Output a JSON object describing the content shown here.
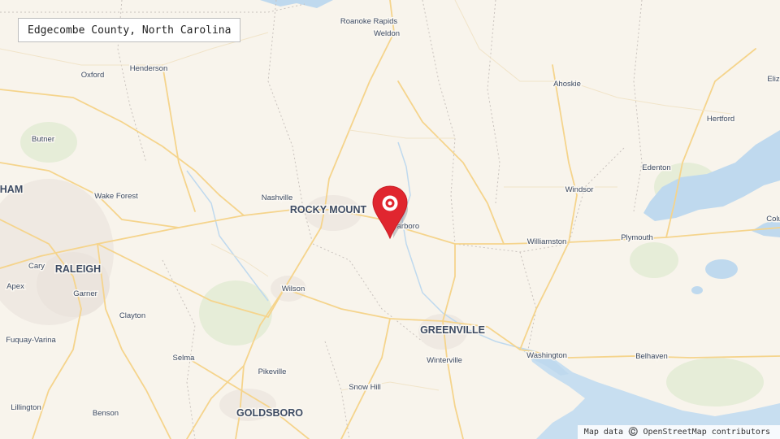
{
  "map": {
    "title": "Edgecombe County, North Carolina",
    "attribution": "Map data ©️ OpenStreetMap contributors",
    "colors": {
      "land": "#f8f4ec",
      "water": "#bfd9ee",
      "roads": "#f5d48c",
      "marker": "#e0262f",
      "label": "#3d4b63"
    },
    "marker": {
      "icon": "map-pin-icon",
      "label": "Tarboro"
    },
    "places": [
      {
        "name": "Roanoke Rapids",
        "size": "town"
      },
      {
        "name": "Weldon",
        "size": "town"
      },
      {
        "name": "Oxford",
        "size": "town"
      },
      {
        "name": "Henderson",
        "size": "town"
      },
      {
        "name": "Ahoskie",
        "size": "town"
      },
      {
        "name": "Eliz",
        "size": "town"
      },
      {
        "name": "Hertford",
        "size": "town"
      },
      {
        "name": "Butner",
        "size": "town"
      },
      {
        "name": "Edenton",
        "size": "town"
      },
      {
        "name": "HAM",
        "size": "major"
      },
      {
        "name": "Wake Forest",
        "size": "town"
      },
      {
        "name": "Nashville",
        "size": "town"
      },
      {
        "name": "ROCKY MOUNT",
        "size": "major"
      },
      {
        "name": "Tarboro",
        "size": "town"
      },
      {
        "name": "Windsor",
        "size": "town"
      },
      {
        "name": "Colu",
        "size": "town"
      },
      {
        "name": "Cary",
        "size": "town"
      },
      {
        "name": "RALEIGH",
        "size": "major"
      },
      {
        "name": "Williamston",
        "size": "town"
      },
      {
        "name": "Plymouth",
        "size": "town"
      },
      {
        "name": "Apex",
        "size": "town"
      },
      {
        "name": "Garner",
        "size": "town"
      },
      {
        "name": "Wilson",
        "size": "town"
      },
      {
        "name": "Clayton",
        "size": "town"
      },
      {
        "name": "GREENVILLE",
        "size": "major"
      },
      {
        "name": "Fuquay-Varina",
        "size": "town"
      },
      {
        "name": "Washington",
        "size": "town"
      },
      {
        "name": "Belhaven",
        "size": "town"
      },
      {
        "name": "Selma",
        "size": "town"
      },
      {
        "name": "Winterville",
        "size": "town"
      },
      {
        "name": "Pikeville",
        "size": "town"
      },
      {
        "name": "Snow Hill",
        "size": "town"
      },
      {
        "name": "Lillington",
        "size": "town"
      },
      {
        "name": "Benson",
        "size": "town"
      },
      {
        "name": "GOLDSBORO",
        "size": "major"
      }
    ]
  }
}
